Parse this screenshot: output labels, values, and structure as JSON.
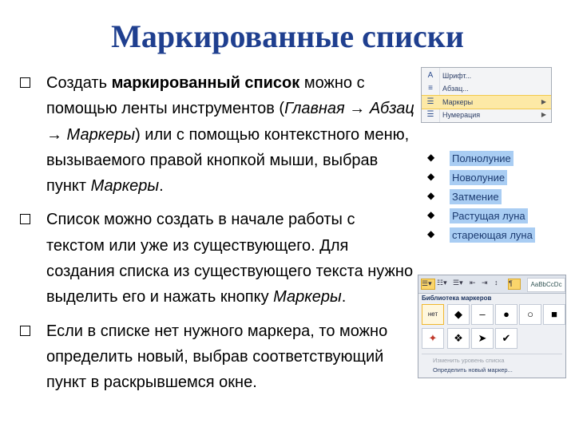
{
  "title": "Маркированные списки",
  "bullets": [
    {
      "text_parts": [
        {
          "t": "Создать ",
          "s": "normal"
        },
        {
          "t": "маркированный список",
          "s": "bold"
        },
        {
          "t": " можно с помощью  ленты инструментов (",
          "s": "normal"
        },
        {
          "t": "Главная → Абзац →  Маркеры",
          "s": "italic"
        },
        {
          "t": ") или с помощью контекстного меню, вызываемого правой кнопкой мыши, выбрав пункт ",
          "s": "normal"
        },
        {
          "t": "Маркеры",
          "s": "italic"
        },
        {
          "t": ".",
          "s": "normal"
        }
      ]
    },
    {
      "text_parts": [
        {
          "t": "Список можно создать в начале работы с текстом или уже из существующего. Для создания  списка из существующего текста нужно выделить его и нажать кнопку ",
          "s": "normal"
        },
        {
          "t": "Маркеры",
          "s": "italic"
        },
        {
          "t": ".",
          "s": "normal"
        }
      ]
    },
    {
      "text_parts": [
        {
          "t": "Если в списке нет нужного маркера, то можно определить новый, выбрав соответствующий пункт в раскрывшемся окне.",
          "s": "normal"
        }
      ]
    }
  ],
  "context_menu": {
    "items": [
      {
        "label": "Шрифт...",
        "icon": "font-icon",
        "glyph": "A"
      },
      {
        "label": "Абзац...",
        "icon": "paragraph-icon",
        "glyph": "≡"
      },
      {
        "label": "Маркеры",
        "icon": "bullets-icon",
        "glyph": "☰",
        "highlighted": true
      },
      {
        "label": "Нумерация",
        "icon": "numbering-icon",
        "glyph": "☰"
      }
    ]
  },
  "sample_list": [
    "Полнолуние",
    "Новолуние",
    "Затмение",
    "Растущая луна",
    "стареющая луна"
  ],
  "library": {
    "title": "Библиотека маркеров",
    "preview": "AaBbCcDc",
    "none_label": "нет",
    "row1": [
      "◆",
      "–",
      "●",
      "○",
      "■"
    ],
    "row2": [
      "✦",
      "❖",
      "➤",
      "✔"
    ],
    "change_level": "Изменить уровень списка",
    "define_new": "Определить новый маркер..."
  }
}
